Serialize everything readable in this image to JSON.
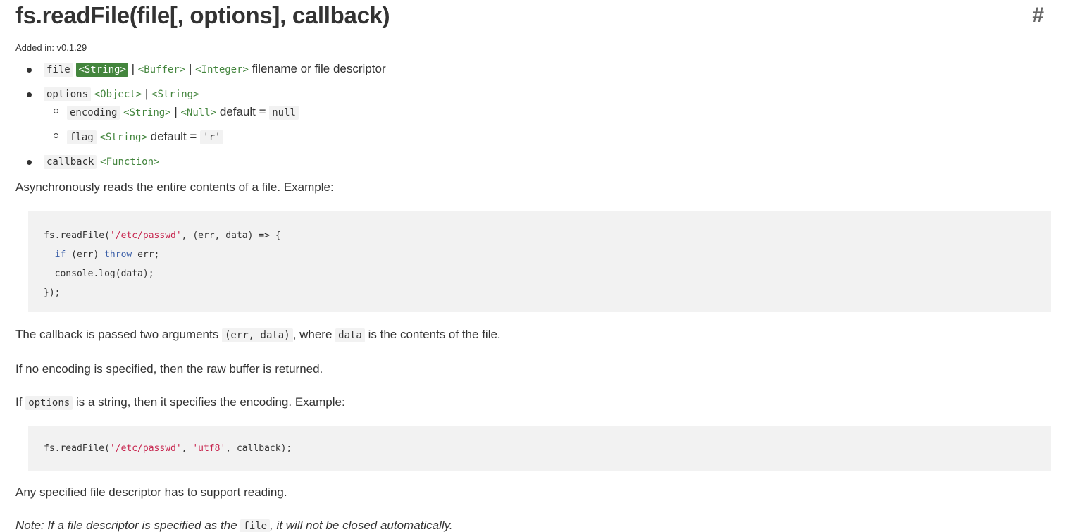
{
  "heading": {
    "title": "fs.readFile(file[, options], callback)",
    "anchor": "#",
    "added_in": "Added in: v0.1.29"
  },
  "params": {
    "file": {
      "name": "file",
      "type_string": "<String>",
      "sep1": "|",
      "type_buffer": "<Buffer>",
      "sep2": "|",
      "type_integer": "<Integer>",
      "desc": "filename or file descriptor"
    },
    "options": {
      "name": "options",
      "type_object": "<Object>",
      "sep1": "|",
      "type_string": "<String>",
      "encoding": {
        "name": "encoding",
        "type_string": "<String>",
        "sep1": "|",
        "type_null": "<Null>",
        "default_label": "default =",
        "default_value": "null"
      },
      "flag": {
        "name": "flag",
        "type_string": "<String>",
        "default_label": "default =",
        "default_value": "'r'"
      }
    },
    "callback": {
      "name": "callback",
      "type_function": "<Function>"
    }
  },
  "paragraphs": {
    "p1": "Asynchronously reads the entire contents of a file. Example:",
    "p2_a": "The callback is passed two arguments",
    "p2_code1": "(err, data)",
    "p2_b": ", where",
    "p2_code2": "data",
    "p2_c": "is the contents of the file.",
    "p3": "If no encoding is specified, then the raw buffer is returned.",
    "p4_a": "If",
    "p4_code": "options",
    "p4_b": "is a string, then it specifies the encoding. Example:",
    "p5": "Any specified file descriptor has to support reading.",
    "note_a": "Note: If a file descriptor is specified as the",
    "note_code": "file",
    "note_b": ", it will not be closed automatically."
  },
  "code1": {
    "l1_a": "fs.readFile(",
    "l1_str": "'/etc/passwd'",
    "l1_b": ", (err, data) => {",
    "l2_kw1": "if",
    "l2_a": " (err) ",
    "l2_kw2": "throw",
    "l2_b": " err;",
    "l3": "console.log(data);",
    "l4": "});"
  },
  "code2": {
    "a": "fs.readFile(",
    "str1": "'/etc/passwd'",
    "b": ", ",
    "str2": "'utf8'",
    "c": ", callback);"
  },
  "colors": {
    "type_link": "#43853d",
    "code_bg": "#f2f2f2",
    "string_literal": "#c7254e",
    "keyword": "#3b5fa8",
    "text": "#333333"
  }
}
